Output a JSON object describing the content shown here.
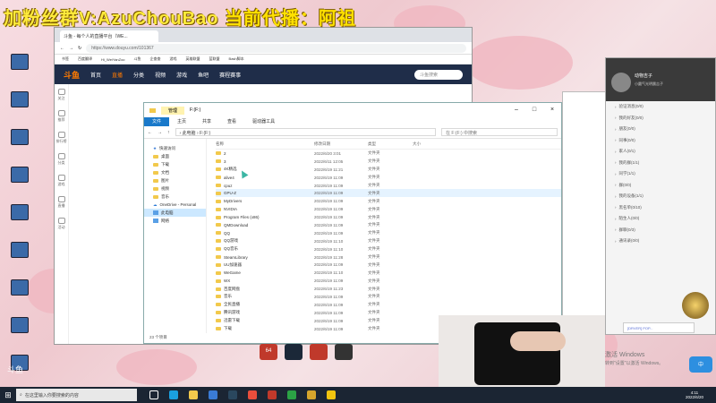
{
  "overlay": {
    "caption_main": "加粉丝群V:AzuChouBao",
    "caption_rest": "当前代播：阿祖"
  },
  "colors": {
    "taskbar": "#1b2533",
    "explorer_accent": "#1979ca",
    "douyu_nav": "#1f2d49",
    "douyu_logo": "#ff7a00"
  },
  "desktop": {
    "icons": [
      "",
      "",
      "",
      "",
      "",
      "",
      "",
      "",
      ""
    ]
  },
  "browser": {
    "tab_title": "斗鱼 - 每个人的直播平台（WE...",
    "url": "https://www.douyu.com/101367",
    "bookmarks": [
      "书签",
      "百度翻译",
      "Hi_WeiYanZoo",
      "斗鱼",
      "企查查",
      "游戏",
      "英雄联盟",
      "蓝联盟",
      "Bash脚本"
    ],
    "nav": {
      "logo": "斗鱼",
      "items": [
        "首页",
        "直播",
        "分类",
        "视频",
        "游戏",
        "鱼吧",
        "赛程赛事"
      ],
      "search_placeholder": "斗鱼搜索"
    },
    "rail": [
      "关注",
      "推荐",
      "排行榜",
      "分类",
      "游戏",
      "直播",
      "活动"
    ]
  },
  "explorer": {
    "context_tab": "管理",
    "title": "F:(F:)",
    "ribbon": [
      "文件",
      "主页",
      "共享",
      "查看",
      "驱动器工具"
    ],
    "address": "› 此电脑 › F:(F:)",
    "search_placeholder": "在 F:(F:) 中搜索",
    "headers": [
      "名称",
      "修改日期",
      "类型",
      "大小"
    ],
    "nav_items": [
      {
        "label": "快速访问",
        "icon": "star-icon",
        "sel": false
      },
      {
        "label": "桌面",
        "icon": "folder-icon",
        "sel": false
      },
      {
        "label": "下载",
        "icon": "folder-icon",
        "sel": false
      },
      {
        "label": "文档",
        "icon": "folder-icon",
        "sel": false
      },
      {
        "label": "图片",
        "icon": "folder-icon",
        "sel": false
      },
      {
        "label": "视频",
        "icon": "folder-icon",
        "sel": false
      },
      {
        "label": "音乐",
        "icon": "folder-icon",
        "sel": false
      },
      {
        "label": "OneDrive - Personal",
        "icon": "cloud-icon",
        "sel": false
      },
      {
        "label": "此电脑",
        "icon": "pc-icon",
        "sel": true
      },
      {
        "label": "网络",
        "icon": "network-icon",
        "sel": false
      }
    ],
    "files": [
      {
        "name": "2",
        "date": "2022/6/20 3:01",
        "type": "文件夹"
      },
      {
        "name": "3",
        "date": "2022/6/11 12:05",
        "type": "文件夹"
      },
      {
        "name": "4K精选",
        "date": "2022/6/19 11:21",
        "type": "文件夹"
      },
      {
        "name": "alive4",
        "date": "2022/6/19 11:09",
        "type": "文件夹"
      },
      {
        "name": "cpuz",
        "date": "2022/6/19 11:09",
        "type": "文件夹"
      },
      {
        "name": "GPU-Z",
        "date": "2022/6/19 11:09",
        "type": "文件夹"
      },
      {
        "name": "MyDrivers",
        "date": "2022/6/19 11:09",
        "type": "文件夹"
      },
      {
        "name": "NVIDIA",
        "date": "2022/6/19 11:09",
        "type": "文件夹"
      },
      {
        "name": "Program Files (x86)",
        "date": "2022/6/19 11:09",
        "type": "文件夹"
      },
      {
        "name": "QMDownload",
        "date": "2022/6/19 11:09",
        "type": "文件夹"
      },
      {
        "name": "QQ",
        "date": "2022/6/19 11:09",
        "type": "文件夹"
      },
      {
        "name": "QQ游戏",
        "date": "2022/6/19 11:10",
        "type": "文件夹"
      },
      {
        "name": "QQ音乐",
        "date": "2022/6/19 11:10",
        "type": "文件夹"
      },
      {
        "name": "SteamLibrary",
        "date": "2022/6/19 11:28",
        "type": "文件夹"
      },
      {
        "name": "UU加速器",
        "date": "2022/6/19 11:09",
        "type": "文件夹"
      },
      {
        "name": "WeGame",
        "date": "2022/6/19 11:10",
        "type": "文件夹"
      },
      {
        "name": "WX",
        "date": "2022/6/19 11:09",
        "type": "文件夹"
      },
      {
        "name": "百度网盘",
        "date": "2022/6/19 11:23",
        "type": "文件夹"
      },
      {
        "name": "音乐",
        "date": "2022/6/19 11:09",
        "type": "文件夹"
      },
      {
        "name": "全民直播",
        "date": "2022/6/19 11:09",
        "type": "文件夹"
      },
      {
        "name": "腾讯游戏",
        "date": "2022/6/19 11:09",
        "type": "文件夹"
      },
      {
        "name": "迅雷下载",
        "date": "2022/6/19 11:09",
        "type": "文件夹"
      },
      {
        "name": "下载",
        "date": "2022/6/19 11:09",
        "type": "文件夹"
      }
    ],
    "status": "23 个项目"
  },
  "chat": {
    "username": "动物吉子",
    "signature": "小圆气光明晨吉子",
    "groups": [
      "验证消息(0/0)",
      "我的好友(0/0)",
      "朋友(0/0)",
      "同事(0/0)",
      "家人(0/1)",
      "我的群(1/1)",
      "同学(1/1)",
      "群(0/0)",
      "我的设备(1/1)",
      "黑名单(0/10)",
      "陌生人(0/0)",
      "群聊(0/3)",
      "通讯录(0/0)"
    ],
    "message_bar": "[DRVER] POP..."
  },
  "activation": {
    "title": "激活 Windows",
    "hint": "转到\"设置\"以激活 Windows。"
  },
  "taskbar": {
    "search": "在这里输入你要搜索的内容",
    "time": "4:11",
    "date": "2022/6/20"
  },
  "game_icons": [
    "64",
    "Steam",
    "UU",
    "Epic"
  ]
}
